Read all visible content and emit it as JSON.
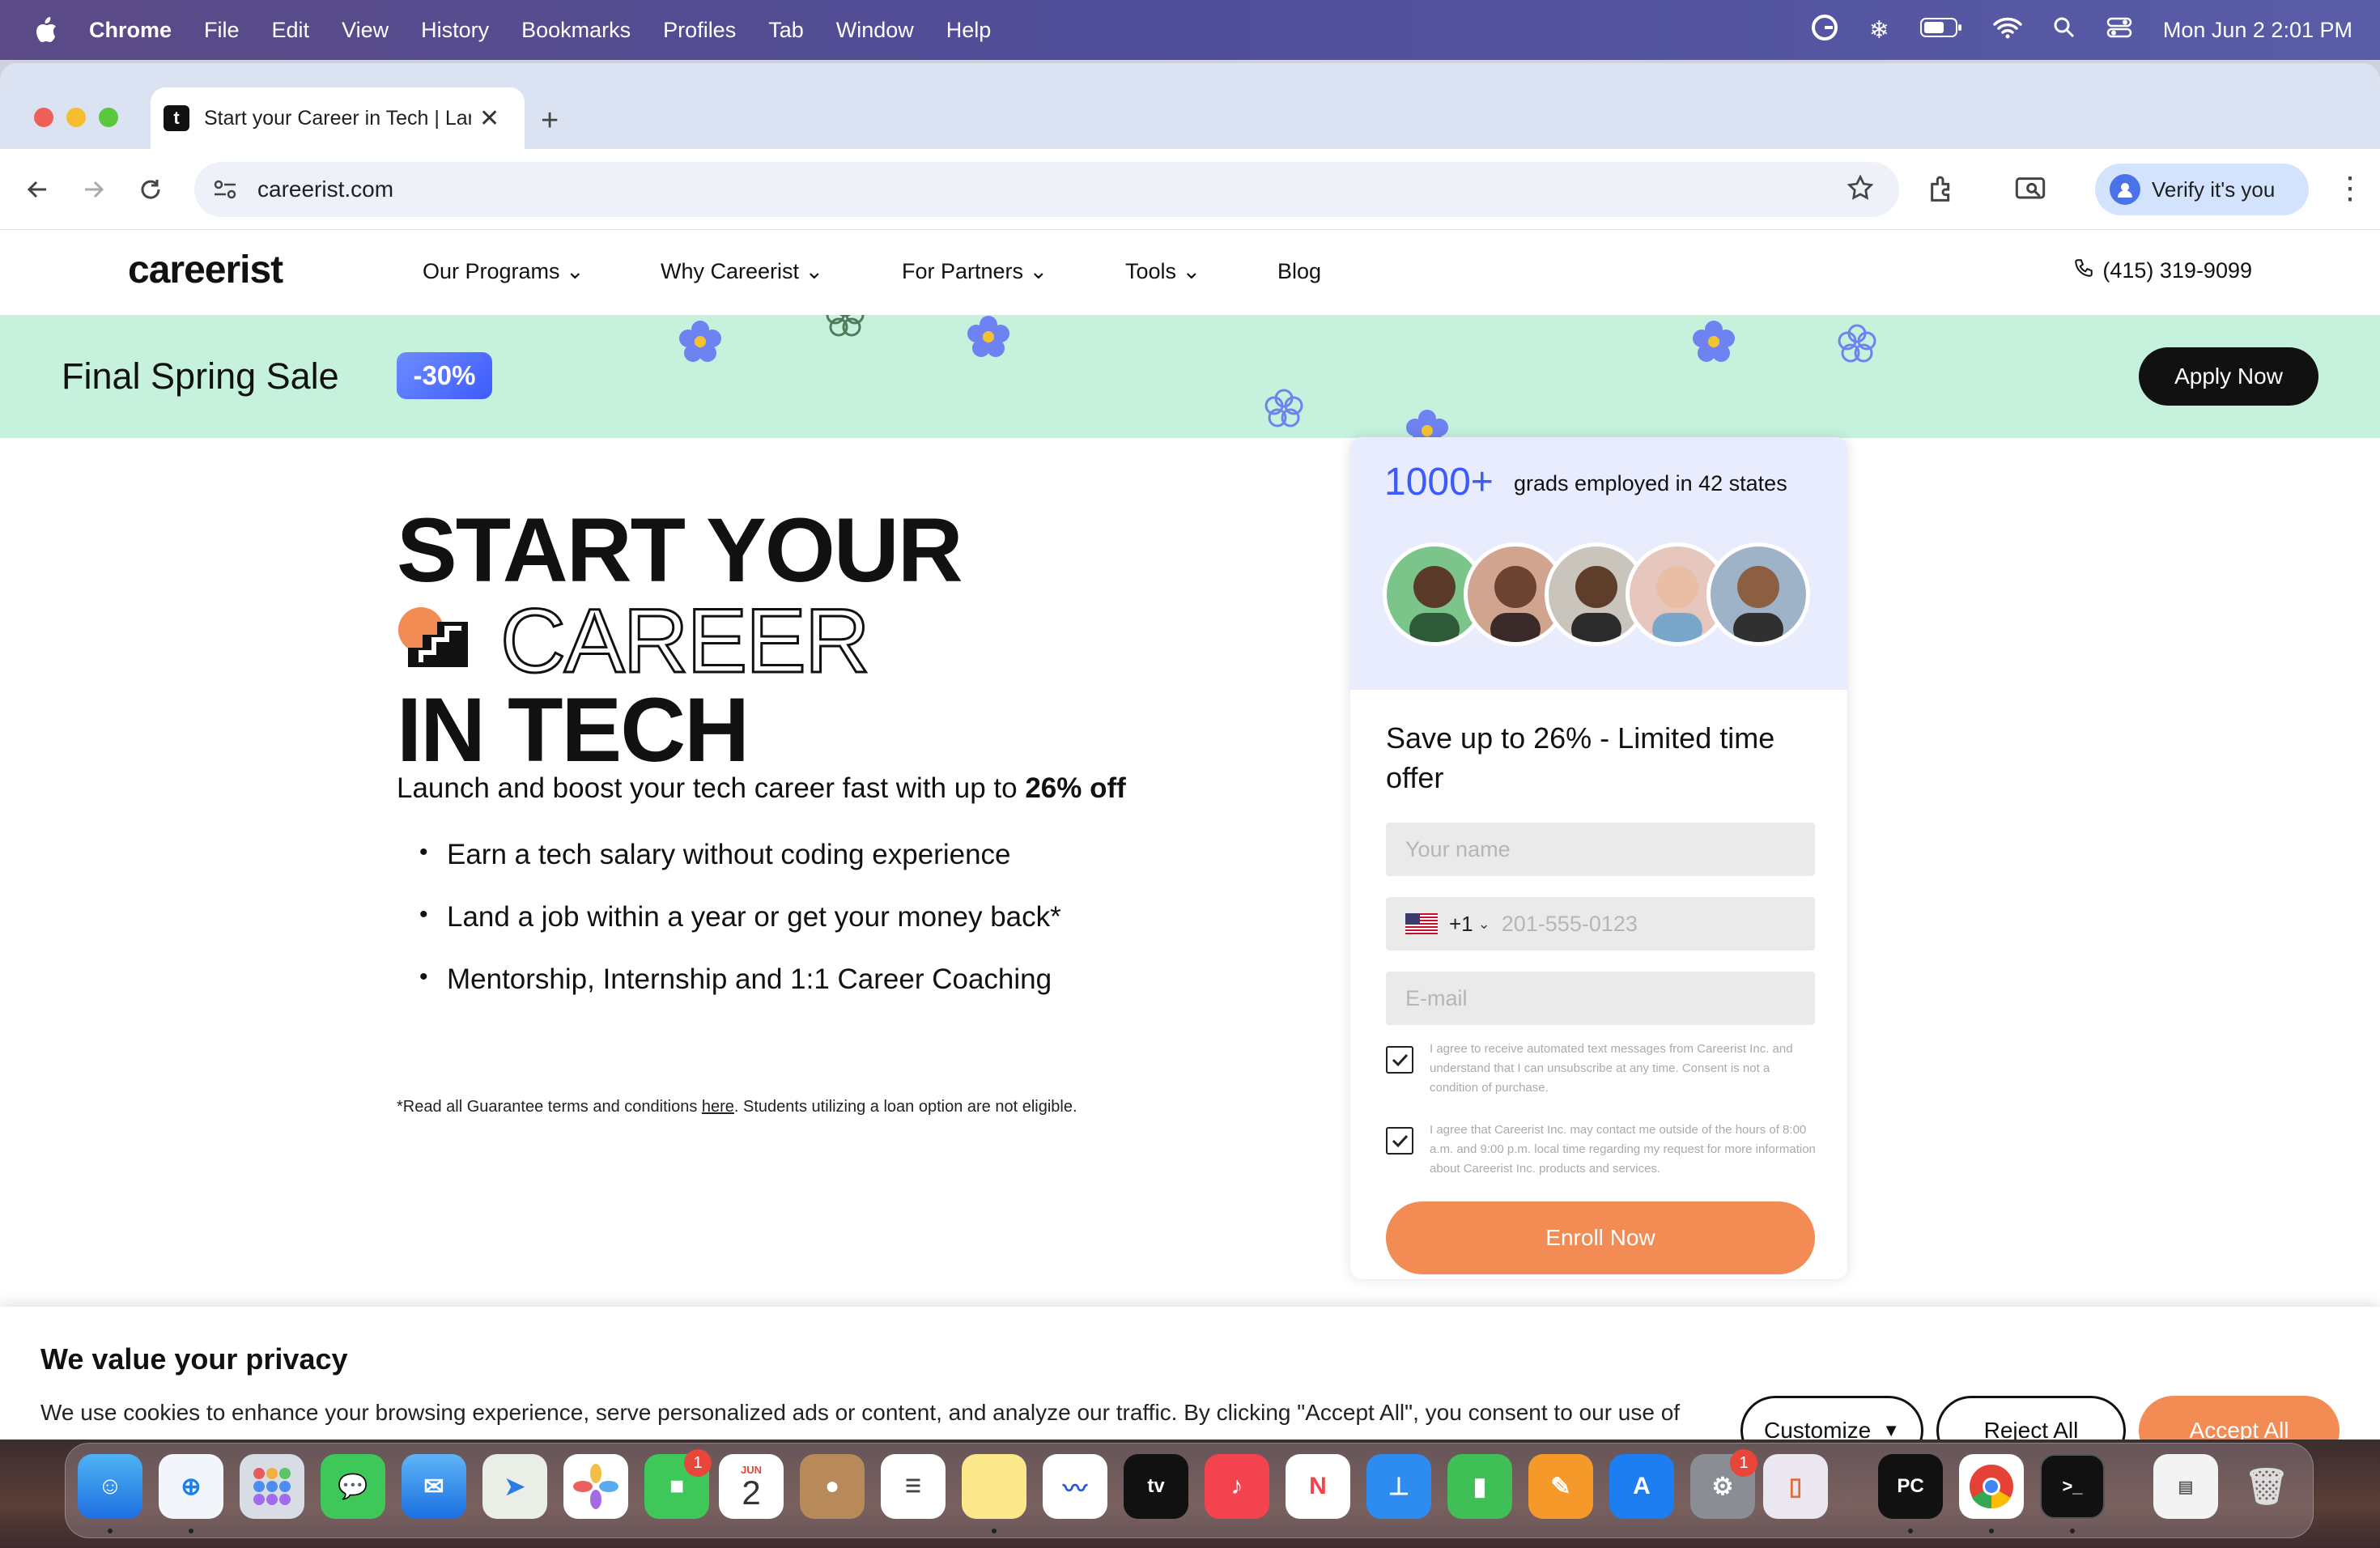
{
  "menubar": {
    "app": "Chrome",
    "items": [
      "File",
      "Edit",
      "View",
      "History",
      "Bookmarks",
      "Profiles",
      "Tab",
      "Window",
      "Help"
    ],
    "clock": "Mon Jun 2  2:01 PM"
  },
  "browser": {
    "tab_title": "Start your Career in Tech | Landing",
    "url": "careerist.com",
    "verify_label": "Verify it's you"
  },
  "site": {
    "logo": "careerist",
    "nav": [
      "Our Programs",
      "Why Careerist",
      "For Partners",
      "Tools",
      "Blog"
    ],
    "phone": "(415) 319-9099"
  },
  "banner": {
    "sale_text": "Final Spring Sale",
    "discount": "-30%",
    "cta": "Apply Now"
  },
  "hero": {
    "line1": "START YOUR",
    "line2": "CAREER",
    "line3": "IN TECH",
    "lead_prefix": "Launch and boost your tech career fast with up to ",
    "lead_bold": "26% off",
    "bullets": [
      "Earn a tech salary without coding experience",
      "Land a job within a year or get your money back*",
      "Mentorship, Internship and 1:1 Career Coaching"
    ],
    "terms_prefix": "*Read all Guarantee terms and conditions ",
    "terms_link": "here",
    "terms_suffix": ". Students utilizing a loan option are not eligible."
  },
  "form": {
    "stat_number": "1000+",
    "stat_text": "grads employed in 42 states",
    "offer": "Save up to 26% - Limited time offer",
    "name_placeholder": "Your name",
    "phone_code": "+1",
    "phone_placeholder": "201-555-0123",
    "email_placeholder": "E-mail",
    "consent1": "I agree to receive automated text messages from Careerist Inc. and understand that I can unsubscribe at any time. Consent is not a condition of purchase.",
    "consent2": "I agree that Careerist Inc. may contact me outside of the hours of 8:00 a.m. and 9:00 p.m. local time regarding my request for more information about Careerist Inc. products and services.",
    "submit": "Enroll Now"
  },
  "cookie": {
    "title": "We value your privacy",
    "text": "We use cookies to enhance your browsing experience, serve personalized ads or content, and analyze our traffic. By clicking \"Accept All\", you consent to our use of cookies.",
    "customize": "Customize",
    "reject": "Reject All",
    "accept": "Accept All"
  },
  "dock": {
    "calendar_month": "JUN",
    "calendar_day": "2",
    "facetime_badge": "1",
    "settings_badge": "1"
  },
  "colors": {
    "accent_orange": "#f38b55",
    "banner_green": "#c6f2dd",
    "stat_blue": "#3b5bff",
    "flower_blue": "#6f82f2"
  }
}
